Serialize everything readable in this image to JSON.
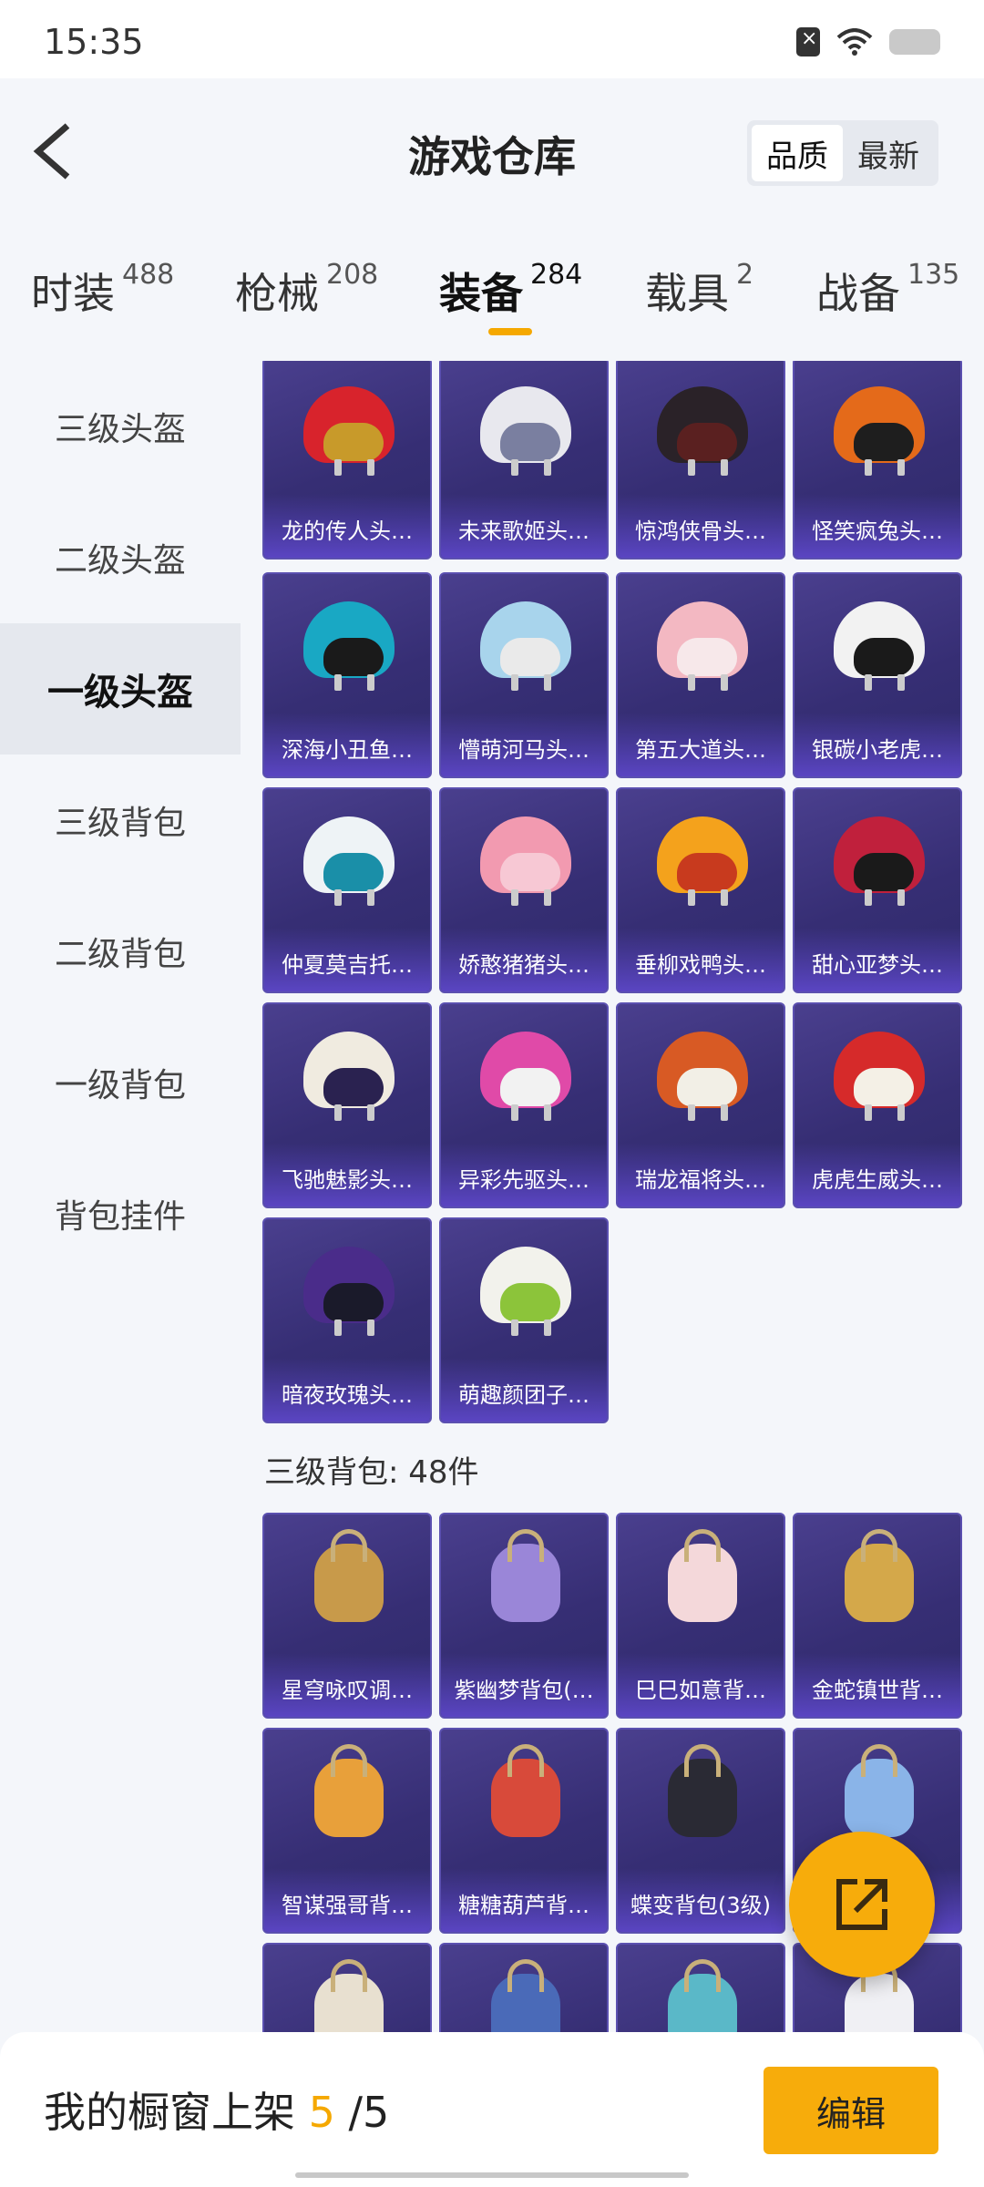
{
  "status": {
    "time": "15:35"
  },
  "header": {
    "title": "游戏仓库",
    "sort_quality": "品质",
    "sort_newest": "最新"
  },
  "tabs": [
    {
      "label": "时装",
      "count": "488"
    },
    {
      "label": "枪械",
      "count": "208"
    },
    {
      "label": "装备",
      "count": "284"
    },
    {
      "label": "载具",
      "count": "2"
    },
    {
      "label": "战备",
      "count": "135"
    }
  ],
  "sidebar": {
    "items": [
      "三级头盔",
      "二级头盔",
      "一级头盔",
      "三级背包",
      "二级背包",
      "一级背包",
      "背包挂件"
    ]
  },
  "helmets": [
    {
      "name": "龙的传人头…",
      "color": "#d8232c",
      "visor": "#c89a2a"
    },
    {
      "name": "未来歌姬头…",
      "color": "#e8e8ee",
      "visor": "#7a7fa0"
    },
    {
      "name": "惊鸿侠骨头…",
      "color": "#2a2228",
      "visor": "#5a2020"
    },
    {
      "name": "怪笑疯兔头…",
      "color": "#e46a1a",
      "visor": "#1e1e1e"
    },
    {
      "name": "深海小丑鱼…",
      "color": "#19a8c4",
      "visor": "#1a1a1a"
    },
    {
      "name": "懵萌河马头…",
      "color": "#a8d4ec",
      "visor": "#eaeaea"
    },
    {
      "name": "第五大道头…",
      "color": "#f3b8c2",
      "visor": "#f7e8ea"
    },
    {
      "name": "银碳小老虎…",
      "color": "#f2f2f2",
      "visor": "#1a1a1a"
    },
    {
      "name": "仲夏莫吉托…",
      "color": "#eef3f6",
      "visor": "#1a8fa8"
    },
    {
      "name": "娇憨猪猪头…",
      "color": "#f29ab0",
      "visor": "#f7c8d4"
    },
    {
      "name": "垂柳戏鸭头…",
      "color": "#f4a21c",
      "visor": "#c83a1e"
    },
    {
      "name": "甜心亚梦头…",
      "color": "#c0203c",
      "visor": "#1a1a1a"
    },
    {
      "name": "飞驰魅影头…",
      "color": "#f0ebe0",
      "visor": "#2a2250"
    },
    {
      "name": "异彩先驱头…",
      "color": "#e04aa8",
      "visor": "#f2f2f2"
    },
    {
      "name": "瑞龙福将头…",
      "color": "#d85a24",
      "visor": "#f2efe6"
    },
    {
      "name": "虎虎生威头…",
      "color": "#d62a2a",
      "visor": "#f4f0e6"
    },
    {
      "name": "暗夜玫瑰头…",
      "color": "#4a2c8a",
      "visor": "#1a1a2a"
    },
    {
      "name": "萌趣颜团子…",
      "color": "#f2f2ec",
      "visor": "#8cc43a"
    }
  ],
  "section": {
    "title": "三级背包: 48件"
  },
  "backpacks": [
    {
      "name": "星穹咏叹调…",
      "color": "#c89a4a"
    },
    {
      "name": "紫幽梦背包(…",
      "color": "#9a86d8"
    },
    {
      "name": "巳巳如意背…",
      "color": "#f4d8da"
    },
    {
      "name": "金蛇镇世背…",
      "color": "#d4a84a"
    },
    {
      "name": "智谋强哥背…",
      "color": "#e8a03a"
    },
    {
      "name": "糖糖葫芦背…",
      "color": "#d84a3a"
    },
    {
      "name": "蝶变背包(3级)",
      "color": "#2a2a34"
    },
    {
      "name": "",
      "color": "#8ab4e8"
    },
    {
      "name": "",
      "color": "#e8e0d0"
    },
    {
      "name": "",
      "color": "#4a6ab8"
    },
    {
      "name": "",
      "color": "#5ab8c8"
    },
    {
      "name": "",
      "color": "#f0f0f4"
    }
  ],
  "bottom": {
    "shop_prefix": "我的橱窗上架",
    "shop_count": "5",
    "shop_total": "/5",
    "edit": "编辑"
  }
}
